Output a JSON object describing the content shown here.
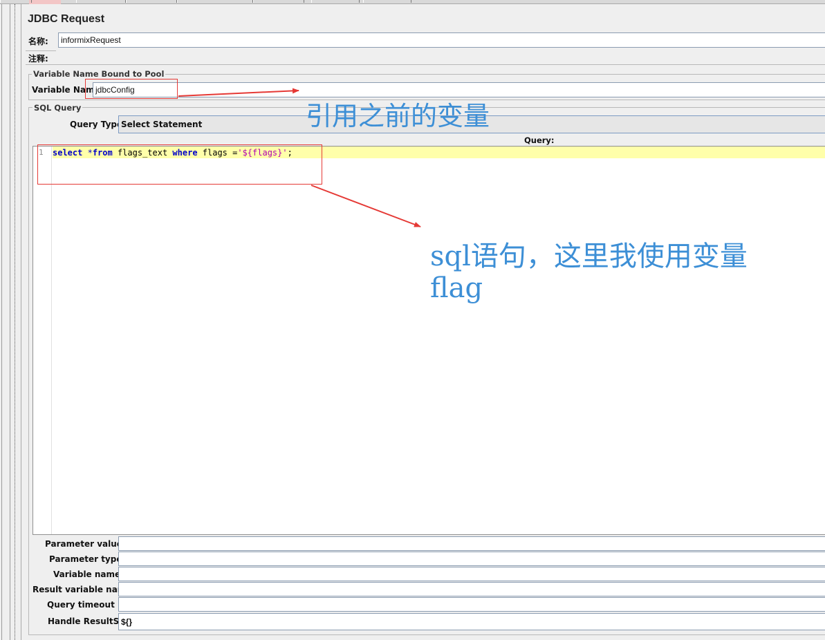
{
  "panel": {
    "title": "JDBC Request",
    "name_label": "名称:",
    "name_value": "informixRequest",
    "comment_label": "注释:",
    "comment_value": ""
  },
  "pool_group": {
    "title": "Variable Name Bound to Pool",
    "variable_name_label": "Variable Name:",
    "variable_name_value": "jdbcConfig"
  },
  "sql_group": {
    "title": "SQL Query",
    "query_type_label": "Query Type:",
    "query_type_value": "Select Statement",
    "query_header": "Query:",
    "line_number": "1",
    "code": {
      "kw_select": "select",
      "op_star": " *",
      "kw_from": "from",
      "mid1": " flags_text ",
      "kw_where": "where",
      "mid2": " flags =",
      "string_value": "'${flags}'",
      "end": ";"
    }
  },
  "params": {
    "parameter_values_label": "Parameter values:",
    "parameter_values_value": "",
    "parameter_types_label": "Parameter types:",
    "parameter_types_value": "",
    "variable_names_label": "Variable names:",
    "variable_names_value": "",
    "result_variable_label": "Result variable name:",
    "result_variable_value": "",
    "query_timeout_label": "Query timeout (s):",
    "query_timeout_value": "",
    "handle_resultset_label": "Handle ResultSet:",
    "handle_resultset_value": "${}"
  },
  "annotations": {
    "note_variable": "引用之前的变量",
    "note_sql_line1": "sql语句，这里我使用变量",
    "note_sql_line2": "flag",
    "color": "#3d8fd6",
    "arrow_color": "#e53935"
  }
}
